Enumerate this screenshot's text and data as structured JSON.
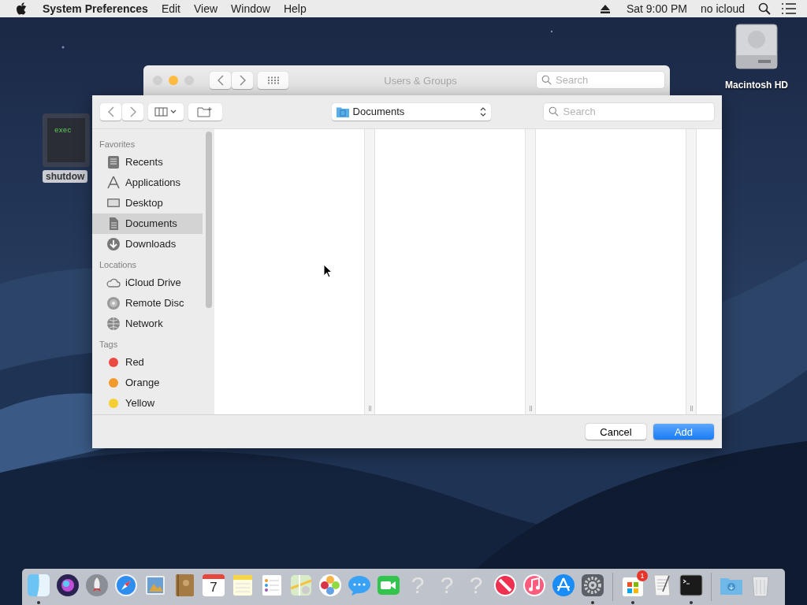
{
  "menubar": {
    "app": "System Preferences",
    "menus": [
      "Edit",
      "View",
      "Window",
      "Help"
    ],
    "clock": "Sat 9:00 PM",
    "user": "no icloud"
  },
  "desktop_icons": [
    {
      "kind": "disk",
      "label": "Macintosh HD"
    },
    {
      "kind": "script",
      "label": "shutdow",
      "screen_text": "exec"
    }
  ],
  "back_window": {
    "title": "Users & Groups",
    "traffic_lights": [
      {
        "enabled": false
      },
      {
        "enabled": true
      },
      {
        "enabled": false
      }
    ],
    "search": {
      "placeholder": "Search"
    }
  },
  "dialog": {
    "location": "Documents",
    "search": {
      "placeholder": "Search"
    },
    "sidebar": [
      {
        "heading": "Favorites",
        "items": [
          {
            "kind": "recents",
            "label": "Recents",
            "selected": false
          },
          {
            "kind": "applications",
            "label": "Applications",
            "selected": false
          },
          {
            "kind": "desktop",
            "label": "Desktop",
            "selected": false
          },
          {
            "kind": "documents",
            "label": "Documents",
            "selected": true
          },
          {
            "kind": "downloads",
            "label": "Downloads",
            "selected": false
          }
        ]
      },
      {
        "heading": "Locations",
        "items": [
          {
            "kind": "icloud",
            "label": "iCloud Drive",
            "selected": false
          },
          {
            "kind": "disc",
            "label": "Remote Disc",
            "selected": false
          },
          {
            "kind": "network",
            "label": "Network",
            "selected": false
          }
        ]
      },
      {
        "heading": "Tags",
        "items": [
          {
            "kind": "tag",
            "label": "Red",
            "color": "#ec4a41",
            "selected": false
          },
          {
            "kind": "tag",
            "label": "Orange",
            "color": "#f39a2c",
            "selected": false
          },
          {
            "kind": "tag",
            "label": "Yellow",
            "color": "#f5cf31",
            "selected": false
          }
        ]
      }
    ],
    "buttons": {
      "cancel": "Cancel",
      "add": "Add"
    }
  },
  "dock": [
    {
      "kind": "finder",
      "running": true
    },
    {
      "kind": "siri",
      "running": false
    },
    {
      "kind": "launchpad",
      "running": false
    },
    {
      "kind": "safari",
      "running": false
    },
    {
      "kind": "preview",
      "running": false
    },
    {
      "kind": "contacts",
      "running": false
    },
    {
      "kind": "calendar",
      "label": "7",
      "running": false
    },
    {
      "kind": "notes",
      "running": false
    },
    {
      "kind": "reminders",
      "running": false
    },
    {
      "kind": "maps",
      "running": false
    },
    {
      "kind": "photos",
      "running": false
    },
    {
      "kind": "messages",
      "running": false
    },
    {
      "kind": "facetime",
      "running": false
    },
    {
      "kind": "missing",
      "label": "?",
      "running": false
    },
    {
      "kind": "missing",
      "label": "?",
      "running": false
    },
    {
      "kind": "missing",
      "label": "?",
      "running": false
    },
    {
      "kind": "news",
      "running": false
    },
    {
      "kind": "music",
      "running": false
    },
    {
      "kind": "appstore",
      "running": false
    },
    {
      "kind": "sysprefs",
      "running": true
    },
    {
      "kind": "separator"
    },
    {
      "kind": "store",
      "badge": "1",
      "running": true
    },
    {
      "kind": "textedit",
      "running": false
    },
    {
      "kind": "terminal",
      "running": true
    },
    {
      "kind": "separator"
    },
    {
      "kind": "downloads",
      "running": false
    },
    {
      "kind": "trash",
      "running": false
    }
  ]
}
